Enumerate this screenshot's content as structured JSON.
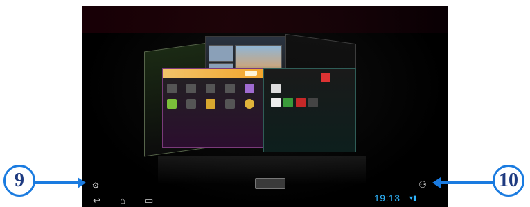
{
  "callouts": {
    "left": "9",
    "right": "10"
  },
  "status_bar": {
    "clock": "19:13"
  },
  "colors": {
    "accent": "#1a7be0",
    "clock": "#2fb6ff"
  },
  "icons": {
    "settings": "gear-icon",
    "back": "back-icon",
    "home": "home-icon",
    "recent": "recent-apps-icon",
    "wifi": "wifi-icon",
    "battery": "battery-icon",
    "notification": "notification-icon"
  }
}
